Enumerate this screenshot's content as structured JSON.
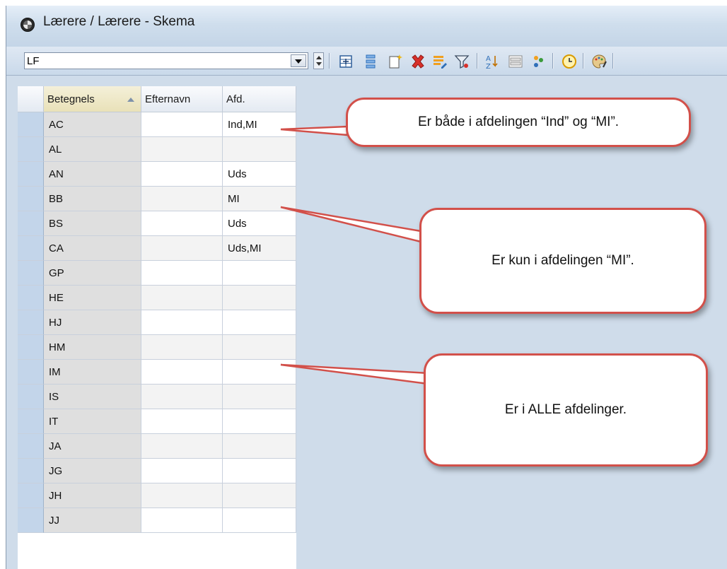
{
  "window": {
    "title": "Lærere / Lærere - Skema"
  },
  "toolbar": {
    "combo_value": "LF",
    "buttons": [
      "grid-view-icon",
      "list-view-icon",
      "new-item-icon",
      "delete-icon",
      "edit-icon",
      "filter-icon",
      "sort-icon",
      "fields-icon",
      "users-icon",
      "clock-icon",
      "palette-icon"
    ]
  },
  "grid": {
    "columns": [
      "Betegnelse",
      "Efternavn",
      "Afd."
    ],
    "header_bet_visible": "Betegnels",
    "rows": [
      {
        "code": "AC",
        "lastname": "",
        "dept": "Ind,MI"
      },
      {
        "code": "AL",
        "lastname": "",
        "dept": ""
      },
      {
        "code": "AN",
        "lastname": "",
        "dept": "Uds"
      },
      {
        "code": "BB",
        "lastname": "",
        "dept": "MI"
      },
      {
        "code": "BS",
        "lastname": "",
        "dept": "Uds"
      },
      {
        "code": "CA",
        "lastname": "",
        "dept": "Uds,MI"
      },
      {
        "code": "GP",
        "lastname": "",
        "dept": ""
      },
      {
        "code": "HE",
        "lastname": "",
        "dept": ""
      },
      {
        "code": "HJ",
        "lastname": "",
        "dept": ""
      },
      {
        "code": "HM",
        "lastname": "",
        "dept": ""
      },
      {
        "code": "IM",
        "lastname": "",
        "dept": ""
      },
      {
        "code": "IS",
        "lastname": "",
        "dept": ""
      },
      {
        "code": "IT",
        "lastname": "",
        "dept": ""
      },
      {
        "code": "JA",
        "lastname": "",
        "dept": ""
      },
      {
        "code": "JG",
        "lastname": "",
        "dept": ""
      },
      {
        "code": "JH",
        "lastname": "",
        "dept": ""
      },
      {
        "code": "JJ",
        "lastname": "",
        "dept": ""
      }
    ]
  },
  "callouts": [
    {
      "text": "Er både i afdelingen “Ind” og “MI”."
    },
    {
      "text": "Er kun i afdelingen “MI”."
    },
    {
      "text": "Er i ALLE afdelinger."
    }
  ],
  "colors": {
    "callout_border": "#d2504a",
    "window_bg": "#cfdcea",
    "code_column_bg": "#dfdfdf"
  }
}
